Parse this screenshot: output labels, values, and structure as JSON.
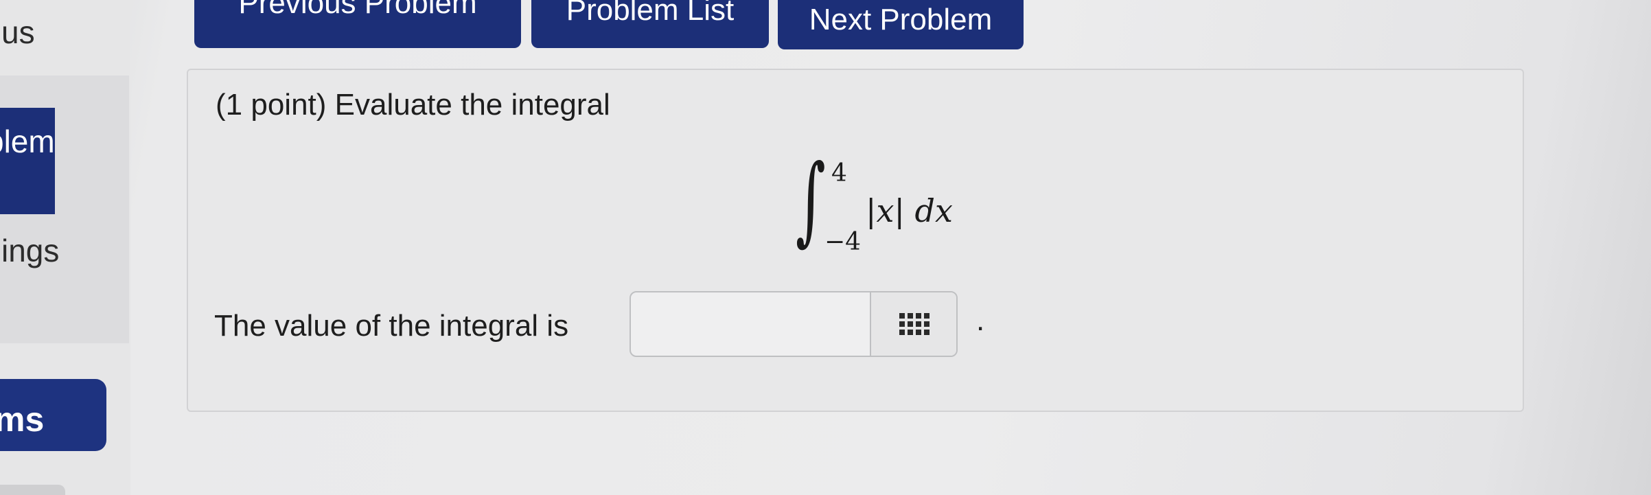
{
  "sidebar": {
    "status_label": "us",
    "problem_label": "blem",
    "settings_label": "ings",
    "problems_label": "ms"
  },
  "nav": {
    "previous_label": "Previous Problem",
    "list_label": "Problem List",
    "next_label": "Next Problem"
  },
  "problem": {
    "intro": "(1 point) Evaluate the integral",
    "integral": {
      "upper_limit": "4",
      "lower_limit": "−4",
      "integrand": "|x|  dx"
    },
    "answer_label": "The value of the integral is",
    "answer_value": "",
    "answer_suffix": ".",
    "palette_icon": "grid-icon"
  },
  "colors": {
    "nav_button": "#1c2f78",
    "sidebar_active": "#1c2f78",
    "problem_box": "#e8e8e9"
  }
}
